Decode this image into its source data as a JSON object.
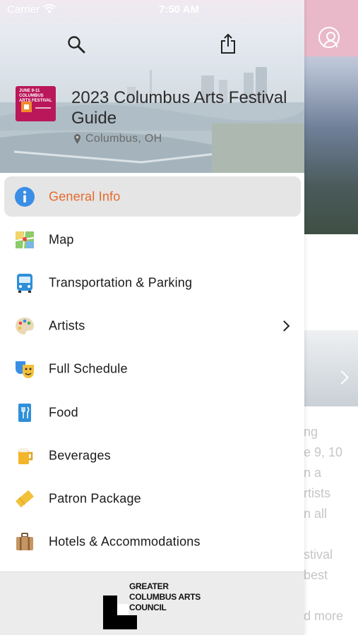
{
  "status_bar": {
    "carrier": "Carrier",
    "time": "7:50 AM"
  },
  "header": {
    "title": "2023 Columbus Arts Festival Guide",
    "location": "Columbus, OH",
    "logo_text": "JUNE 9-11 COLUMBUS ARTS FESTIVAL"
  },
  "menu": {
    "items": [
      {
        "label": "General Info",
        "icon": "info-icon",
        "selected": true
      },
      {
        "label": "Map",
        "icon": "map-icon"
      },
      {
        "label": "Transportation & Parking",
        "icon": "bus-icon"
      },
      {
        "label": "Artists",
        "icon": "palette-icon",
        "has_submenu": true
      },
      {
        "label": "Full Schedule",
        "icon": "theater-masks-icon"
      },
      {
        "label": "Food",
        "icon": "food-icon"
      },
      {
        "label": "Beverages",
        "icon": "beer-icon"
      },
      {
        "label": "Patron Package",
        "icon": "ticket-icon"
      },
      {
        "label": "Hotels & Accommodations",
        "icon": "suitcase-icon"
      }
    ]
  },
  "footer": {
    "logo_text": "GREATER COLUMBUS ARTS COUNCIL"
  },
  "background_page": {
    "text_lines": [
      "ng",
      "e 9, 10",
      "n a",
      "rtists",
      "n all",
      "",
      "stival",
      "best",
      "",
      "d more"
    ]
  },
  "colors": {
    "accent": "#e8692a",
    "selected_bg": "#e5e5e5",
    "brand": "#b9175a"
  }
}
